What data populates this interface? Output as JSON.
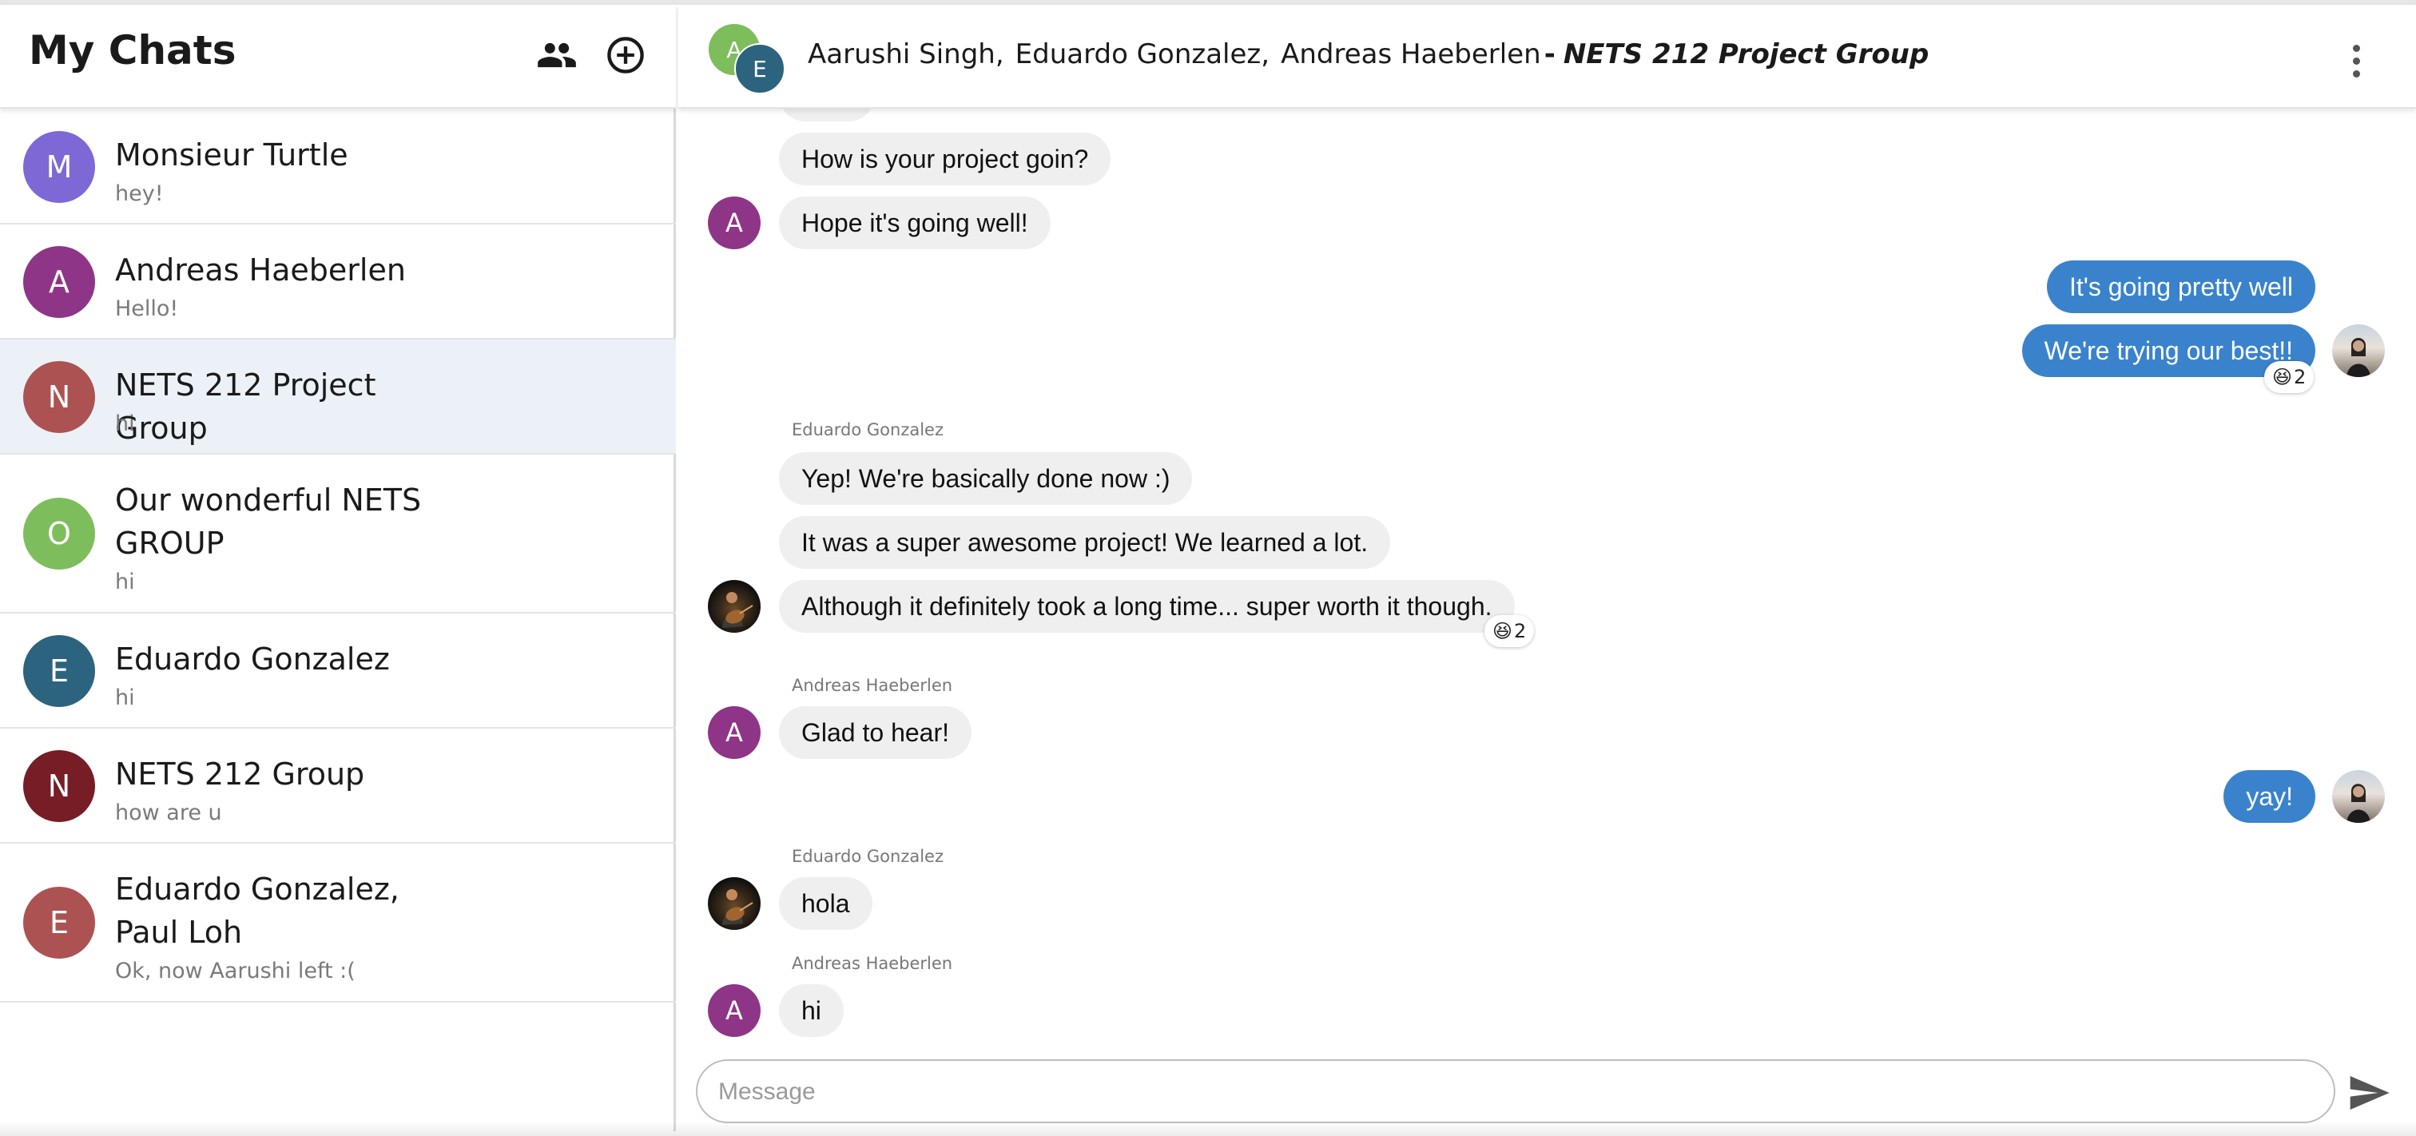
{
  "sidebar": {
    "title": "My Chats",
    "chats": [
      {
        "initial": "M",
        "name": "Monsieur Turtle",
        "preview": "hey!",
        "color": "#7e68d6"
      },
      {
        "initial": "A",
        "name": "Andreas Haeberlen",
        "preview": "Hello!",
        "color": "#8e3587"
      },
      {
        "initial": "N",
        "name": "NETS 212 Project Group",
        "preview": "hi",
        "color": "#ad5252"
      },
      {
        "initial": "O",
        "name": "Our wonderful NETS GROUP",
        "preview": "hi",
        "color": "#7ebd5c"
      },
      {
        "initial": "E",
        "name": "Eduardo Gonzalez",
        "preview": "hi",
        "color": "#2c637e"
      },
      {
        "initial": "N",
        "name": "NETS 212 Group",
        "preview": "how are u",
        "color": "#771d26"
      },
      {
        "initial": "E",
        "name": "Eduardo Gonzalez, Paul Loh",
        "preview": "Ok, now Aarushi left :(",
        "color": "#ad5252"
      }
    ]
  },
  "header": {
    "avatar_a": "A",
    "avatar_e": "E",
    "member1": "Aarushi Singh,",
    "member2": "Eduardo Gonzalez,",
    "member3": "Andreas Haeberlen",
    "dash": "-",
    "group_name": "NETS 212 Project Group"
  },
  "messages": {
    "m1": "How is your project goin?",
    "m2": "Hope it's going well!",
    "m2_avatar": "A",
    "m3": "It's going pretty well",
    "m4": "We're trying our best!!",
    "m4_react_emoji": "😆",
    "m4_react_count": "2",
    "sender_eduardo_1": "Eduardo Gonzalez",
    "m5": "Yep! We're basically done now :)",
    "m6": "It was a super awesome project! We learned a lot.",
    "m7": "Although it definitely took a long time... super worth it though.",
    "m7_react_emoji": "😆",
    "m7_react_count": "2",
    "sender_andreas_1": "Andreas Haeberlen",
    "m8": "Glad to hear!",
    "m8_avatar": "A",
    "m9": "yay!",
    "sender_eduardo_2": "Eduardo Gonzalez",
    "m10": "hola",
    "sender_andreas_2": "Andreas Haeberlen",
    "m11": "hi",
    "m11_avatar": "A"
  },
  "composer": {
    "placeholder": "Message"
  },
  "colors": {
    "andreas": "#8e3587",
    "outgoing": "#3a83cc",
    "incoming": "#efefef",
    "header_a": "#7ebd5c",
    "header_e": "#2c637e"
  }
}
